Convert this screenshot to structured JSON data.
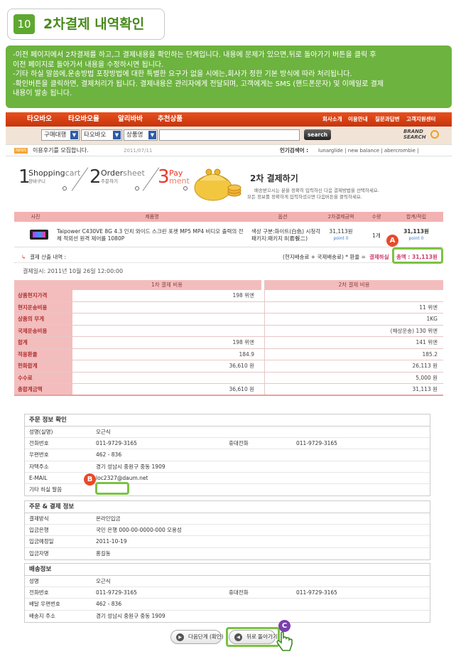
{
  "header": {
    "step_number": "10",
    "title": "2차결제 내역확인"
  },
  "note": {
    "lines": [
      "-이전 페이지에서 2차결제를  하고,그 결제내용을 확인하는 단계입니다.  내용에 문제가 있으면,뒤로 돌아가기 버튼을 클릭 후",
      "  이전 페이지로 돌아가서 내용을 수정하시면 됩니다.",
      "-기타 하실 말씀에,운송방법 포장방법에 대한 특별한 요구가 없을 시에는,회사가 정한 기본 방식에 따라 처리됩니다.",
      "-확인버튼을 클릭하면, 결제처리가 됩니다. 결제내용은 관리자에게 전달되며, 고객에게는 SMS (핸드폰문자) 및 이메일로 결제",
      "  내용이 발송 됩니다."
    ]
  },
  "nav": {
    "tabs": [
      "타오바오",
      "타오바오몰",
      "알리바바",
      "추천상품"
    ],
    "util": [
      "회사소개",
      "이용안내",
      "질문과답변",
      "고객지원센터"
    ]
  },
  "search": {
    "category": "구매대행",
    "site": "타오바오",
    "field": "상품명",
    "button": "search",
    "brand_line1": "BRAND",
    "brand_line2": "SEARCH"
  },
  "infobar": {
    "badge": "NEWS",
    "notice": "이용후기를 모집합니다.",
    "date": "2011/07/11",
    "popular_label": "인기검색어 :",
    "popular": "lunarglide | new balance | abercrombie |"
  },
  "steps": [
    {
      "num": "1",
      "label": "Shopping",
      "label2": "cart",
      "sub": "장바구니"
    },
    {
      "num": "2",
      "label": "Order",
      "label2": "sheet",
      "sub": "주문하기"
    },
    {
      "num": "3",
      "label": "Pay",
      "label2": "ment",
      "sub": ""
    }
  ],
  "payment": {
    "title": "2차 결제하기",
    "desc1": "배송받으시는 분을 정확히 입력하신 다음 결제방법을 선택하세요.",
    "desc2": "모든 정보를 정확하게 입력하셨으면 다음버튼을 클릭하세요."
  },
  "product_table": {
    "headers": [
      "사진",
      "제품명",
      "옵션",
      "2차결제금액",
      "수량",
      "합계/적립"
    ],
    "name1": "Taipower C430VE 8G 4.3 인치 와이드 스크린 포켓 MP5 MP4 비디오 출력의 전",
    "name2": "체 적외선 원격 제어를 1080P",
    "opt1": "색상 구분:화이트(白色) 시청각",
    "opt2": "패키지:패키지 II(套餐二)",
    "amount": "31,113원",
    "point": "point 0",
    "qty": "1개",
    "total": "31,113원",
    "total_point": "point 0"
  },
  "calc": {
    "label": "결제 산출 내역 :",
    "formula": "(현지배송료 + 국제배송료) * 환율 = ",
    "formula_tail": "결제하실",
    "sum_label": "총액 : 31,113원"
  },
  "paydate": "결제일시: 2011년 10월 26일   12:00:00",
  "cost_table": {
    "h1": "1차 결제 비용",
    "h2": "2차 결제 비용",
    "rows": [
      {
        "label": "상품현지가격",
        "c1": "198 위엔",
        "c2": ""
      },
      {
        "label": "현지운송비용",
        "c1": "",
        "c2": "11 위엔"
      },
      {
        "label": "상품의 무게",
        "c1": "",
        "c2": "1KG"
      },
      {
        "label": "국제운송비용",
        "c1": "",
        "c2": "(해상운송)  130 위엔"
      },
      {
        "label": "합계",
        "c1": "198 위엔",
        "c2": "141 위엔"
      },
      {
        "label": "적용환율",
        "c1": "184.9",
        "c2": "185.2"
      },
      {
        "label": "한화합계",
        "c1": "36,610 원",
        "c2": "26,113 원"
      },
      {
        "label": "수수료",
        "c1": "",
        "c2": "5,000 원"
      },
      {
        "label": "총합계금액",
        "c1": "36,610 원",
        "c2": "31,113 원"
      }
    ]
  },
  "order_info": {
    "title": "주문 정보 확인",
    "name_k": "성명(실명)",
    "name_v": "오근식",
    "tel_k": "전화번호",
    "tel_v": "011-9729-3165",
    "mobile_k": "휴대전화",
    "mobile_v": "011-9729-3165",
    "zip_k": "우편번호",
    "zip_v": "462 - 836",
    "addr_k": "자택주소",
    "addr_v": "경기 성남시 중원구 중동 1909",
    "email_k": "E-MAIL",
    "email_v": "loc2327@daum.net",
    "memo_k": "기타 하실 말씀",
    "memo_v": ""
  },
  "pay_info": {
    "title": "주문 & 결제 정보",
    "method_k": "결제방식",
    "method_v": "온라인입금",
    "bank_k": "입금은행",
    "bank_v": "국민 은행  000-00-0000-000 오용성",
    "date_k": "입금예정일",
    "date_v": "2011-10-19",
    "payer_k": "입금자명",
    "payer_v": "홍길동"
  },
  "ship_info": {
    "title": "배송정보",
    "name_k": "성명",
    "name_v": "오근식",
    "tel_k": "전화번호",
    "tel_v": "011-9729-3165",
    "mobile_k": "휴대전화",
    "mobile_v": "011-9729-3165",
    "zip_k": "배달 우편번호",
    "zip_v": "462 - 836",
    "addr_k": "배송지 주소",
    "addr_v": "경기 성남시 중원구 중동 1909"
  },
  "buttons": {
    "next": "다음단계 (확인)",
    "back": "뒤로 돌아가기"
  },
  "markers": {
    "a": "A",
    "b": "B",
    "c": "C"
  },
  "colors": {
    "accent_green": "#6db33f",
    "nav_orange": "#d9421a",
    "table_pink": "#f4bdbd",
    "marker_red": "#e84a2a",
    "marker_purple": "#7a3fb0"
  }
}
